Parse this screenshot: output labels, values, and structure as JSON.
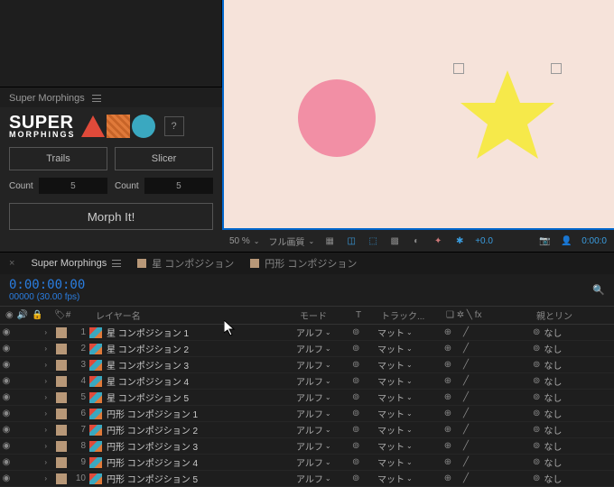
{
  "panel": {
    "title": "Super Morphings",
    "logo_super": "SUPER",
    "logo_morph": "MORPHINGS",
    "help": "?",
    "trails": "Trails",
    "slicer": "Slicer",
    "count_label": "Count",
    "count_val_1": "5",
    "count_val_2": "5",
    "morph": "Morph It!"
  },
  "preview": {
    "zoom": "50 %",
    "quality": "フル画質",
    "exposure": "+0.0",
    "time_right": "0:00:0"
  },
  "tabs": {
    "active": "Super Morphings",
    "t2": "星 コンポジション",
    "t3": "円形 コンポジション"
  },
  "tl": {
    "timecode": "0:00:00:00",
    "fps": "00000 (30.00 fps)",
    "col_name": "レイヤー名",
    "col_mode": "モード",
    "col_t": "T",
    "col_track": "トラック...",
    "col_parent": "親とリン",
    "mode_val": "アルフ",
    "track_val": "マット",
    "parent_val": "なし",
    "rows": [
      {
        "n": "1",
        "name": "星 コンポジション 1"
      },
      {
        "n": "2",
        "name": "星 コンポジション 2"
      },
      {
        "n": "3",
        "name": "星 コンポジション 3"
      },
      {
        "n": "4",
        "name": "星 コンポジション 4"
      },
      {
        "n": "5",
        "name": "星 コンポジション 5"
      },
      {
        "n": "6",
        "name": "円形 コンポジション 1"
      },
      {
        "n": "7",
        "name": "円形 コンポジション 2"
      },
      {
        "n": "8",
        "name": "円形 コンポジション 3"
      },
      {
        "n": "9",
        "name": "円形 コンポジション 4"
      },
      {
        "n": "10",
        "name": "円形 コンポジション 5"
      }
    ]
  },
  "switch_header": "❑ ✲ ╲ fx",
  "icons": {
    "eye": "◉",
    "lock": "🔒",
    "tag": "🏷",
    "hash": "#",
    "spiral": "⊚",
    "chev": "⌄",
    "sun": "☀",
    "slash": "╱",
    "anchor": "⊕"
  }
}
